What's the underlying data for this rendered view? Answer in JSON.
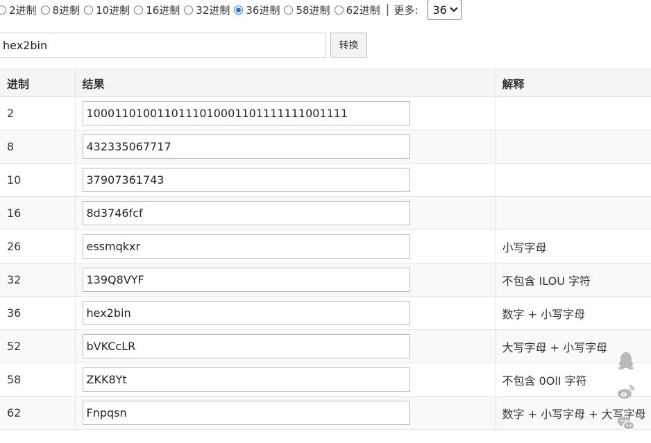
{
  "radix_options": [
    {
      "label": "2进制",
      "checked": false
    },
    {
      "label": "8进制",
      "checked": false
    },
    {
      "label": "10进制",
      "checked": false
    },
    {
      "label": "16进制",
      "checked": false
    },
    {
      "label": "32进制",
      "checked": false
    },
    {
      "label": "36进制",
      "checked": true
    },
    {
      "label": "58进制",
      "checked": false
    },
    {
      "label": "62进制",
      "checked": false
    }
  ],
  "separator": "|",
  "more_label": "更多:",
  "more_select_value": "36",
  "input_value": "hex2bin",
  "convert_label": "转换",
  "table": {
    "headers": [
      "进制",
      "结果",
      "解释"
    ],
    "rows": [
      {
        "radix": "2",
        "result": "1000110100110111010001101111111001111",
        "note": ""
      },
      {
        "radix": "8",
        "result": "432335067717",
        "note": ""
      },
      {
        "radix": "10",
        "result": "37907361743",
        "note": ""
      },
      {
        "radix": "16",
        "result": "8d3746fcf",
        "note": ""
      },
      {
        "radix": "26",
        "result": "essmqkxr",
        "note": "小写字母"
      },
      {
        "radix": "32",
        "result": "139Q8VYF",
        "note": "不包含 ILOU 字符"
      },
      {
        "radix": "36",
        "result": "hex2bin",
        "note": "数字 + 小写字母"
      },
      {
        "radix": "52",
        "result": "bVKCcLR",
        "note": "大写字母 + 小写字母"
      },
      {
        "radix": "58",
        "result": "ZKK8Yt",
        "note": "不包含 0OlI 字符"
      },
      {
        "radix": "62",
        "result": "Fnpqsn",
        "note": "数字 + 小写字母 + 大写字母"
      }
    ]
  },
  "floating_icons": [
    "qq-penguin-icon",
    "weibo-icon",
    "wechat-icon"
  ],
  "colors": {
    "accent": "#1a73e8"
  }
}
